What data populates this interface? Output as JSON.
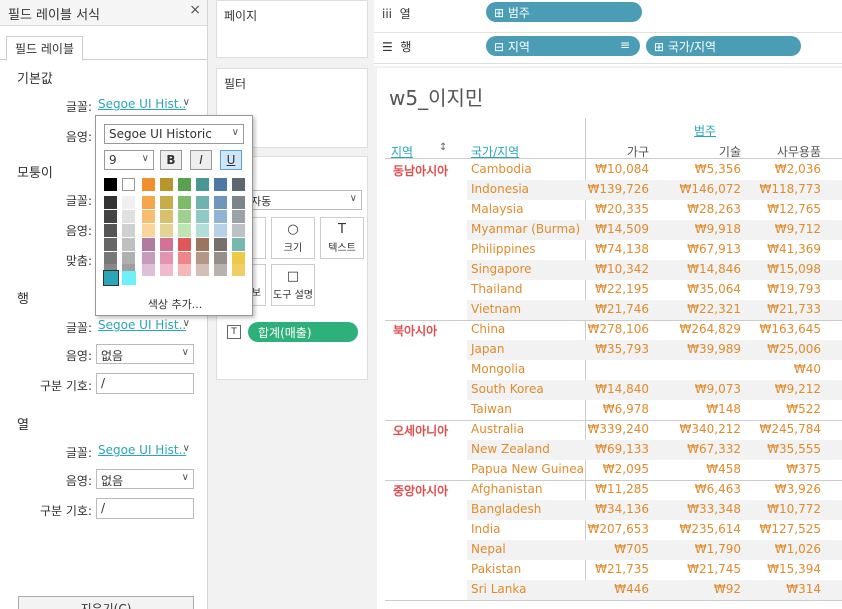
{
  "left": {
    "title": "필드 레이블 서식",
    "close": "×",
    "tab": "필드 레이블",
    "sections": {
      "default": "기본값",
      "corner": "모퉁이",
      "row": "행",
      "col": "열"
    },
    "labels": {
      "font": "글꼴:",
      "shading": "음영:",
      "align": "맞춤:",
      "separator": "구분 기호:"
    },
    "font_value": "Segoe UI Hist..",
    "none": "없음",
    "separator_value": "/",
    "clear": "지우기(C)"
  },
  "mid": {
    "pages": "페이지",
    "filters": "필터",
    "marks_auto": "자동",
    "size": "크기",
    "text": "텍스트",
    "detail_partial": "보",
    "tooltip": "도구 설명",
    "sum_pill": "합계(매출)"
  },
  "shelves": {
    "cols_icon": "iii",
    "cols_label": "열",
    "rows_icon": "☰",
    "rows_label": "행",
    "col_pill": "범주",
    "row_pill_1": "지역",
    "row_pill_2": "국가/지역"
  },
  "popup": {
    "font_name": "Segoe UI Historic",
    "font_size": "9",
    "bold": "B",
    "italic": "I",
    "underline": "U",
    "add_color": "색상 추가..."
  },
  "view": {
    "title": "w5_이지민",
    "col_group_header": "범주",
    "row_header_region": "지역",
    "row_header_country": "국가/지역",
    "sort_icon": "sort-ascending-icon",
    "columns": [
      "가구",
      "기술",
      "사무용품"
    ],
    "groups": [
      {
        "region": "동남아시아",
        "rows": [
          {
            "country": "Cambodia",
            "v": [
              "₩10,084",
              "₩5,356",
              "₩2,036"
            ]
          },
          {
            "country": "Indonesia",
            "v": [
              "₩139,726",
              "₩146,072",
              "₩118,773"
            ]
          },
          {
            "country": "Malaysia",
            "v": [
              "₩20,335",
              "₩28,263",
              "₩12,765"
            ]
          },
          {
            "country": "Myanmar (Burma)",
            "v": [
              "₩14,509",
              "₩9,918",
              "₩9,712"
            ]
          },
          {
            "country": "Philippines",
            "v": [
              "₩74,138",
              "₩67,913",
              "₩41,369"
            ]
          },
          {
            "country": "Singapore",
            "v": [
              "₩10,342",
              "₩14,846",
              "₩15,098"
            ]
          },
          {
            "country": "Thailand",
            "v": [
              "₩22,195",
              "₩35,064",
              "₩19,793"
            ]
          },
          {
            "country": "Vietnam",
            "v": [
              "₩21,746",
              "₩22,321",
              "₩21,733"
            ]
          }
        ]
      },
      {
        "region": "북아시아",
        "rows": [
          {
            "country": "China",
            "v": [
              "₩278,106",
              "₩264,829",
              "₩163,645"
            ]
          },
          {
            "country": "Japan",
            "v": [
              "₩35,793",
              "₩39,989",
              "₩25,006"
            ]
          },
          {
            "country": "Mongolia",
            "v": [
              "",
              "",
              "₩40"
            ]
          },
          {
            "country": "South Korea",
            "v": [
              "₩14,840",
              "₩9,073",
              "₩9,212"
            ]
          },
          {
            "country": "Taiwan",
            "v": [
              "₩6,978",
              "₩148",
              "₩522"
            ]
          }
        ]
      },
      {
        "region": "오세아니아",
        "rows": [
          {
            "country": "Australia",
            "v": [
              "₩339,240",
              "₩340,212",
              "₩245,784"
            ]
          },
          {
            "country": "New Zealand",
            "v": [
              "₩69,133",
              "₩67,332",
              "₩35,555"
            ]
          },
          {
            "country": "Papua New Guinea",
            "v": [
              "₩2,095",
              "₩458",
              "₩375"
            ]
          }
        ]
      },
      {
        "region": "중앙아시아",
        "rows": [
          {
            "country": "Afghanistan",
            "v": [
              "₩11,285",
              "₩6,463",
              "₩3,926"
            ]
          },
          {
            "country": "Bangladesh",
            "v": [
              "₩34,136",
              "₩33,348",
              "₩10,772"
            ]
          },
          {
            "country": "India",
            "v": [
              "₩207,653",
              "₩235,614",
              "₩127,525"
            ]
          },
          {
            "country": "Nepal",
            "v": [
              "₩705",
              "₩1,790",
              "₩1,026"
            ]
          },
          {
            "country": "Pakistan",
            "v": [
              "₩21,735",
              "₩21,745",
              "₩15,394"
            ]
          },
          {
            "country": "Sri Lanka",
            "v": [
              "₩446",
              "₩92",
              "₩314"
            ]
          }
        ]
      }
    ]
  },
  "colors": {
    "accent_teal": "#2aa6b8",
    "pill_blue": "#4a9db5",
    "pill_green": "#2eb07a",
    "region_red": "#e04d4d",
    "value_orange": "#e08b2c"
  },
  "swatches": {
    "palette": [
      [
        "#000000",
        "#ffffff",
        "#f28e2b",
        "#b8962e",
        "#59a14f",
        "#499894",
        "#4e79a7",
        "#5e6770"
      ],
      [
        "#333333",
        "#f0f0f0",
        "#f5a64b",
        "#c9ab4a",
        "#7dba6a",
        "#6fb2ae",
        "#6f95bd",
        "#7c858c"
      ],
      [
        "#444444",
        "#e0e0e0",
        "#f8bd70",
        "#d8c06c",
        "#9fd08e",
        "#90c8c4",
        "#92b4d4",
        "#9ba2a8"
      ],
      [
        "#555555",
        "#d0d0d0",
        "#fbd49a",
        "#e4d395",
        "#c0e3b3",
        "#b3ddda",
        "#b7d1e8",
        "#bcc1c5"
      ],
      [
        "#666666",
        "#c0c0c0",
        "#b07aa1",
        "#d37295",
        "#e15759",
        "#9c755f",
        "#796f6a",
        "#76b7b2"
      ],
      [
        "#777777",
        "#b0b0b0",
        "#c89abb",
        "#e294b0",
        "#ec8688",
        "#b69686",
        "#968e8a",
        "#edc948"
      ],
      [
        "#888888",
        "#a0a0a0",
        "#dfbfd6",
        "#f1b9cd",
        "#f7b6b7",
        "#d3bfb5",
        "#b8b2ae",
        "#f1ce63"
      ]
    ],
    "recent": [
      "#2aa6b8",
      "#6ff0f8"
    ]
  }
}
